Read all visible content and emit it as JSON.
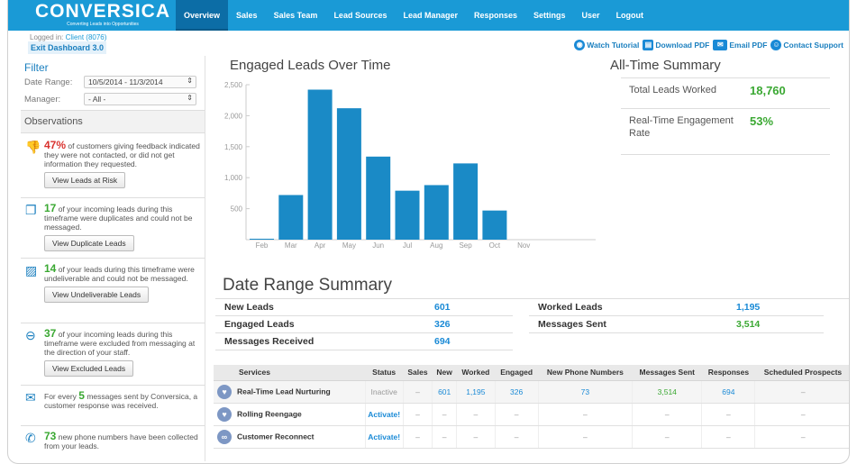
{
  "brand": {
    "name": "CONVERSICA",
    "tagline": "Converting Leads into Opportunities"
  },
  "nav": [
    "Overview",
    "Sales",
    "Sales Team",
    "Lead Sources",
    "Lead Manager",
    "Responses",
    "Settings",
    "User",
    "Logout"
  ],
  "session": {
    "logged_in_label": "Logged in:",
    "client": "Client (8076)",
    "exit_label": "Exit Dashboard 3.0"
  },
  "toplinks": {
    "tutorial": "Watch Tutorial",
    "download": "Download PDF",
    "email": "Email PDF",
    "support": "Contact Support"
  },
  "filter": {
    "title": "Filter",
    "date_label": "Date Range:",
    "date_value": "10/5/2014 - 11/3/2014",
    "manager_label": "Manager:",
    "manager_value": "- All -"
  },
  "observations": {
    "title": "Observations",
    "items": [
      {
        "num": "47%",
        "text": " of customers giving feedback indicated they were not contacted, or did not get information they requested.",
        "button": "View Leads at Risk"
      },
      {
        "num": "17",
        "text": " of your incoming leads during this timeframe were duplicates and could not be messaged.",
        "button": "View Duplicate Leads"
      },
      {
        "num": "14",
        "text": " of your leads during this timeframe were undeliverable and could not be messaged.",
        "button": "View Undeliverable Leads"
      },
      {
        "num": "37",
        "text": " of your incoming leads during this timeframe were excluded from messaging at the direction of your staff.",
        "button": "View Excluded Leads"
      },
      {
        "pre": "For every ",
        "num": "5",
        "text": " messages sent by Conversica, a customer response was received."
      },
      {
        "num": "73",
        "text": " new phone numbers have been collected from your leads."
      }
    ]
  },
  "chart_data": {
    "type": "bar",
    "title": "Engaged Leads Over Time",
    "categories": [
      "Feb",
      "Mar",
      "Apr",
      "May",
      "Jun",
      "Jul",
      "Aug",
      "Sep",
      "Oct",
      "Nov"
    ],
    "values": [
      15,
      720,
      2420,
      2120,
      1340,
      790,
      880,
      1230,
      470,
      0
    ],
    "yticks": [
      500,
      1000,
      1500,
      2000,
      2500
    ],
    "ytick_labels": [
      "500",
      "1,000",
      "1,500",
      "2,000",
      "2,500"
    ],
    "ylim": [
      0,
      2500
    ],
    "color": "#1a8ac6"
  },
  "summary": {
    "title": "All-Time Summary",
    "rows": [
      {
        "label": "Total Leads Worked",
        "value": "18,760"
      },
      {
        "label": "Real-Time Engagement Rate",
        "value": "53%"
      }
    ]
  },
  "drs": {
    "title": "Date Range Summary",
    "left": [
      {
        "label": "New Leads",
        "value": "601"
      },
      {
        "label": "Engaged Leads",
        "value": "326"
      },
      {
        "label": "Messages Received",
        "value": "694"
      }
    ],
    "right": [
      {
        "label": "Worked Leads",
        "value": "1,195"
      },
      {
        "label": "Messages Sent",
        "value": "3,514"
      }
    ]
  },
  "services": {
    "headers": [
      "Services",
      "Status",
      "Sales",
      "New",
      "Worked",
      "Engaged",
      "New Phone Numbers",
      "Messages Sent",
      "Responses",
      "Scheduled Prospects"
    ],
    "rows": [
      {
        "name": "Real-Time Lead Nurturing",
        "status": "Inactive",
        "sales": "–",
        "new": "601",
        "worked": "1,195",
        "engaged": "326",
        "phones": "73",
        "sent": "3,514",
        "responses": "694",
        "scheduled": "–"
      },
      {
        "name": "Rolling Reengage",
        "status": "Activate!",
        "sales": "–",
        "new": "–",
        "worked": "–",
        "engaged": "–",
        "phones": "–",
        "sent": "–",
        "responses": "–",
        "scheduled": "–"
      },
      {
        "name": "Customer Reconnect",
        "status": "Activate!",
        "sales": "–",
        "new": "–",
        "worked": "–",
        "engaged": "–",
        "phones": "–",
        "sent": "–",
        "responses": "–",
        "scheduled": "–"
      }
    ]
  }
}
